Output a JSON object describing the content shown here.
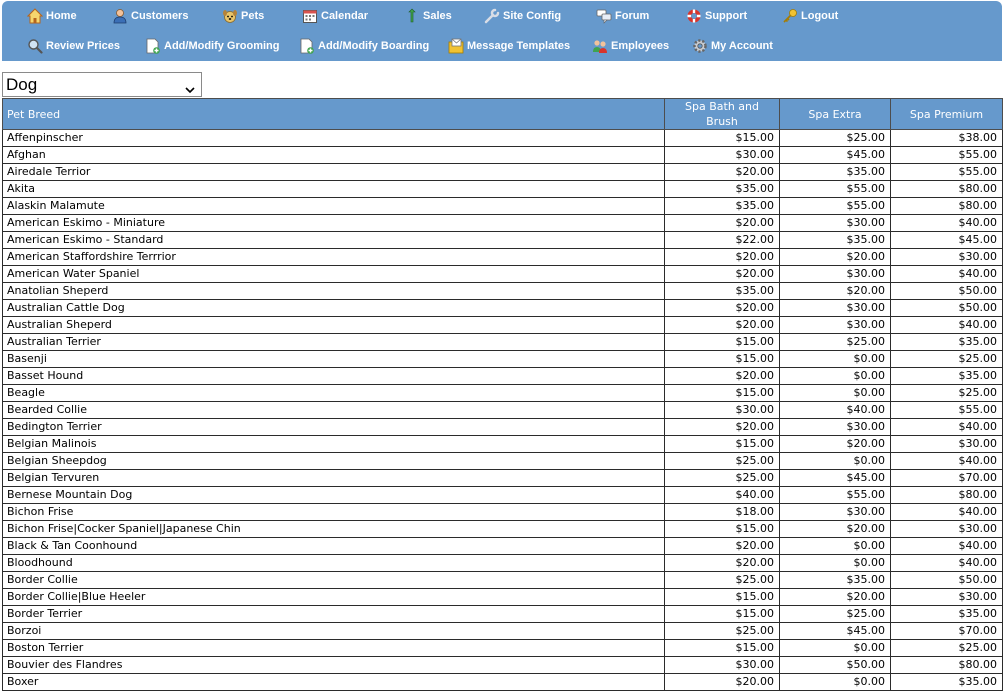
{
  "nav": {
    "row1": [
      {
        "label": "Home",
        "icon": "home-icon"
      },
      {
        "label": "Customers",
        "icon": "customer-icon"
      },
      {
        "label": "Pets",
        "icon": "pet-icon"
      },
      {
        "label": "Calendar",
        "icon": "calendar-icon"
      },
      {
        "label": "Sales",
        "icon": "money-icon"
      },
      {
        "label": "Site Config",
        "icon": "wrench-icon"
      },
      {
        "label": "Forum",
        "icon": "chat-icon"
      },
      {
        "label": "Support",
        "icon": "lifebuoy-icon"
      },
      {
        "label": "Logout",
        "icon": "key-icon"
      }
    ],
    "row2": [
      {
        "label": "Review Prices",
        "icon": "magnifier-icon"
      },
      {
        "label": "Add/Modify Grooming",
        "icon": "add-document-icon"
      },
      {
        "label": "Add/Modify Boarding",
        "icon": "add-document-icon"
      },
      {
        "label": "Message Templates",
        "icon": "envelope-folder-icon"
      },
      {
        "label": "Employees",
        "icon": "employees-icon"
      },
      {
        "label": "My Account",
        "icon": "gear-icon"
      }
    ]
  },
  "species_select": {
    "value": "Dog"
  },
  "table": {
    "headers": [
      "Pet Breed",
      "Spa Bath and Brush",
      "Spa Extra",
      "Spa Premium"
    ],
    "rows": [
      [
        "Affenpinscher",
        "$15.00",
        "$25.00",
        "$38.00"
      ],
      [
        "Afghan",
        "$30.00",
        "$45.00",
        "$55.00"
      ],
      [
        "Airedale Terrior",
        "$20.00",
        "$35.00",
        "$55.00"
      ],
      [
        "Akita",
        "$35.00",
        "$55.00",
        "$80.00"
      ],
      [
        "Alaskin Malamute",
        "$35.00",
        "$55.00",
        "$80.00"
      ],
      [
        "American Eskimo - Miniature",
        "$20.00",
        "$30.00",
        "$40.00"
      ],
      [
        "American Eskimo - Standard",
        "$22.00",
        "$35.00",
        "$45.00"
      ],
      [
        "American Staffordshire Terrrior",
        "$20.00",
        "$20.00",
        "$30.00"
      ],
      [
        "American Water Spaniel",
        "$20.00",
        "$30.00",
        "$40.00"
      ],
      [
        "Anatolian Sheperd",
        "$35.00",
        "$20.00",
        "$50.00"
      ],
      [
        "Australian Cattle Dog",
        "$20.00",
        "$30.00",
        "$50.00"
      ],
      [
        "Australian Sheperd",
        "$20.00",
        "$30.00",
        "$40.00"
      ],
      [
        "Australian Terrier",
        "$15.00",
        "$25.00",
        "$35.00"
      ],
      [
        "Basenji",
        "$15.00",
        "$0.00",
        "$25.00"
      ],
      [
        "Basset Hound",
        "$20.00",
        "$0.00",
        "$35.00"
      ],
      [
        "Beagle",
        "$15.00",
        "$0.00",
        "$25.00"
      ],
      [
        "Bearded Collie",
        "$30.00",
        "$40.00",
        "$55.00"
      ],
      [
        "Bedington Terrier",
        "$20.00",
        "$30.00",
        "$40.00"
      ],
      [
        "Belgian Malinois",
        "$15.00",
        "$20.00",
        "$30.00"
      ],
      [
        "Belgian Sheepdog",
        "$25.00",
        "$0.00",
        "$40.00"
      ],
      [
        "Belgian Tervuren",
        "$25.00",
        "$45.00",
        "$70.00"
      ],
      [
        "Bernese Mountain Dog",
        "$40.00",
        "$55.00",
        "$80.00"
      ],
      [
        "Bichon Frise",
        "$18.00",
        "$30.00",
        "$40.00"
      ],
      [
        "Bichon Frise|Cocker Spaniel|Japanese Chin",
        "$15.00",
        "$20.00",
        "$30.00"
      ],
      [
        "Black & Tan Coonhound",
        "$20.00",
        "$0.00",
        "$40.00"
      ],
      [
        "Bloodhound",
        "$20.00",
        "$0.00",
        "$40.00"
      ],
      [
        "Border Collie",
        "$25.00",
        "$35.00",
        "$50.00"
      ],
      [
        "Border Collie|Blue Heeler",
        "$15.00",
        "$20.00",
        "$30.00"
      ],
      [
        "Border Terrier",
        "$15.00",
        "$25.00",
        "$35.00"
      ],
      [
        "Borzoi",
        "$25.00",
        "$45.00",
        "$70.00"
      ],
      [
        "Boston Terrier",
        "$15.00",
        "$0.00",
        "$25.00"
      ],
      [
        "Bouvier des Flandres",
        "$30.00",
        "$50.00",
        "$80.00"
      ],
      [
        "Boxer",
        "$20.00",
        "$0.00",
        "$35.00"
      ]
    ]
  }
}
